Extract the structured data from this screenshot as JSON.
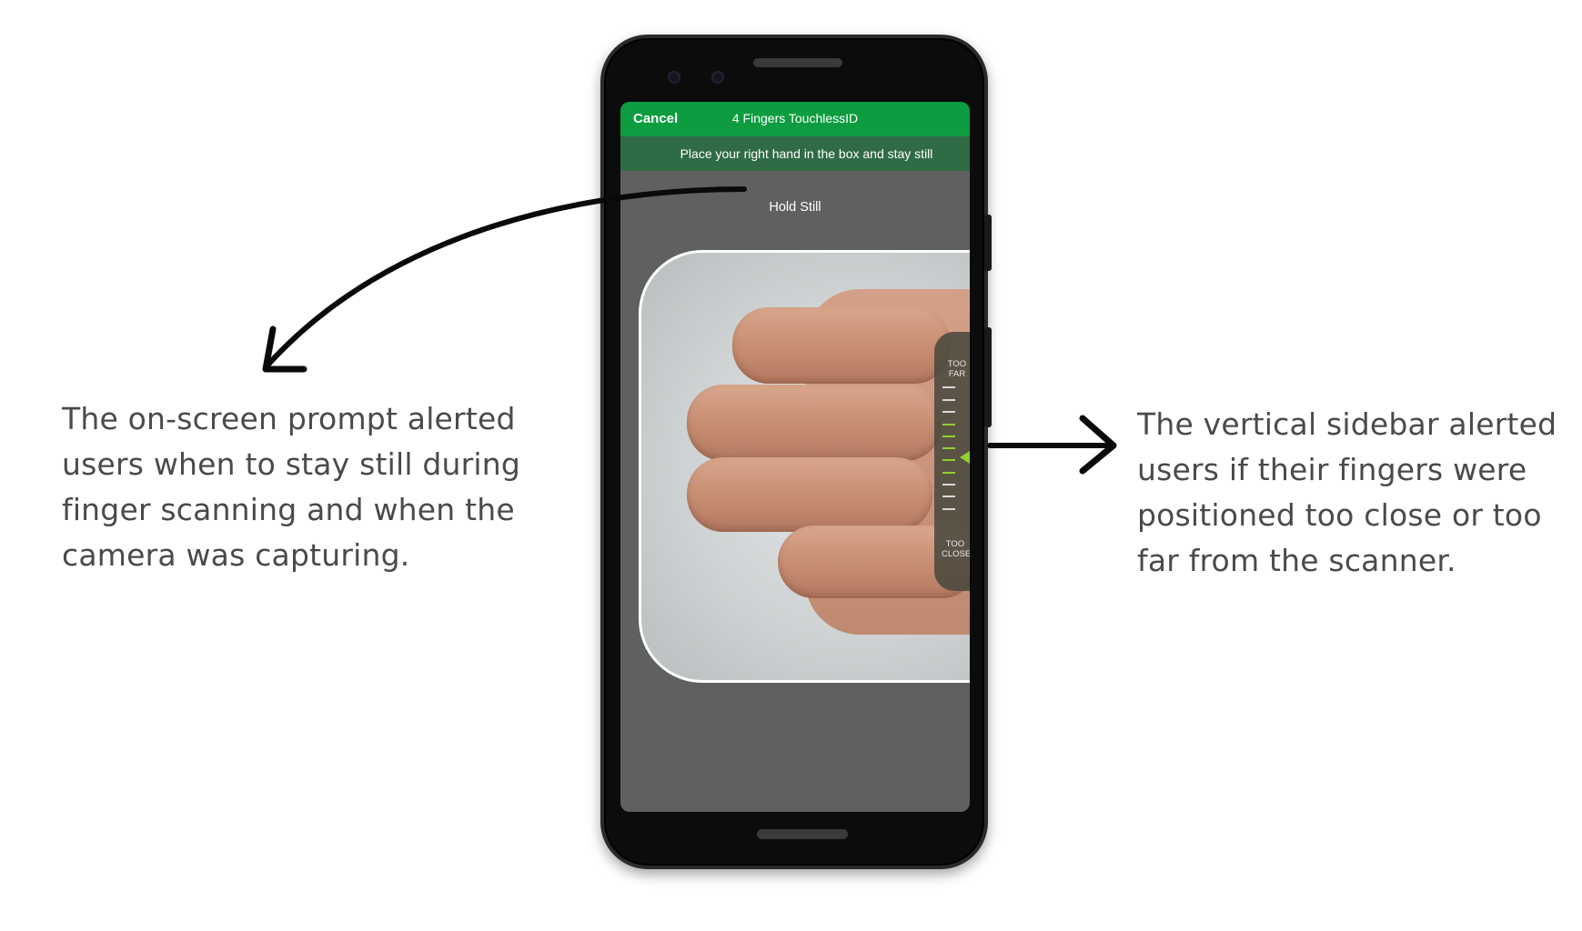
{
  "annotations": {
    "left_text": "The on-screen prompt alerted users when to stay still during finger scanning and when the camera was capturing.",
    "right_text": "The vertical sidebar alerted users if their fingers were positioned too close or too far from the scanner."
  },
  "app": {
    "cancel_label": "Cancel",
    "title": "4 Fingers TouchlessID",
    "instruction": "Place your right hand in the box and stay still",
    "status": "Hold Still"
  },
  "distance_sidebar": {
    "top_label": "TOO FAR",
    "bottom_label": "TOO CLOSE",
    "accent_color": "#8ed22f"
  },
  "colors": {
    "app_bar": "#0d9c3f",
    "instruction_bar": "#2f6b45",
    "annotation_text": "#4a4a4a"
  }
}
